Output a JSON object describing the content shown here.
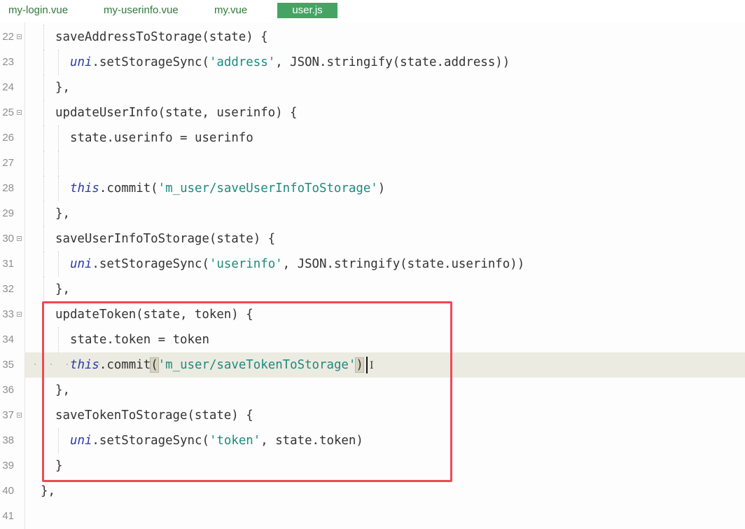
{
  "tabs": [
    {
      "label": "my-login.vue",
      "active": false
    },
    {
      "label": "my-userinfo.vue",
      "active": false
    },
    {
      "label": "my.vue",
      "active": false
    },
    {
      "label": "user.js",
      "active": true
    }
  ],
  "editor": {
    "line_numbers": [
      "22",
      "23",
      "24",
      "25",
      "26",
      "27",
      "28",
      "29",
      "30",
      "31",
      "32",
      "33",
      "34",
      "35",
      "36",
      "37",
      "38",
      "39",
      "40",
      "41"
    ],
    "lines": {
      "l22": {
        "name": "saveAddressToStorage",
        "rest": "(state) {"
      },
      "l23": {
        "kw": "uni",
        "mid": ".setStorageSync(",
        "str": "'address'",
        "rest": ", JSON.stringify(state.address))"
      },
      "l24": {
        "text": "},"
      },
      "l25": {
        "text": "updateUserInfo(state, userinfo) {"
      },
      "l26": {
        "text": "state.userinfo = userinfo"
      },
      "l28": {
        "kw": "this",
        "mid": ".commit(",
        "str": "'m_user/saveUserInfoToStorage'",
        "rest": ")"
      },
      "l29": {
        "text": "},"
      },
      "l30": {
        "text": "saveUserInfoToStorage(state) {"
      },
      "l31": {
        "kw": "uni",
        "mid": ".setStorageSync(",
        "str": "'userinfo'",
        "rest": ", JSON.stringify(state.userinfo))"
      },
      "l32": {
        "text": "},"
      },
      "l33": {
        "text": "updateToken(state, token) {"
      },
      "l34": {
        "text": "state.token = token"
      },
      "l35": {
        "kw": "this",
        "mid": ".commit",
        "open": "(",
        "str": "'m_user/saveTokenToStorage'",
        "close": ")"
      },
      "l36": {
        "text": "},"
      },
      "l37": {
        "text": "saveTokenToStorage(state) {"
      },
      "l38": {
        "kw": "uni",
        "mid": ".setStorageSync(",
        "str": "'token'",
        "rest": ", state.token)"
      },
      "l39": {
        "text": "}"
      },
      "l40": {
        "text": "},"
      }
    },
    "whitespace_dots": "· · · · · · ·"
  },
  "colors": {
    "tab_active_bg": "#45a463",
    "tab_text": "#2f7a3a",
    "keyword": "#2b3aa8",
    "string": "#1d8a7e",
    "highlight_box": "#ee4a55",
    "current_line": "#ecebe1"
  }
}
